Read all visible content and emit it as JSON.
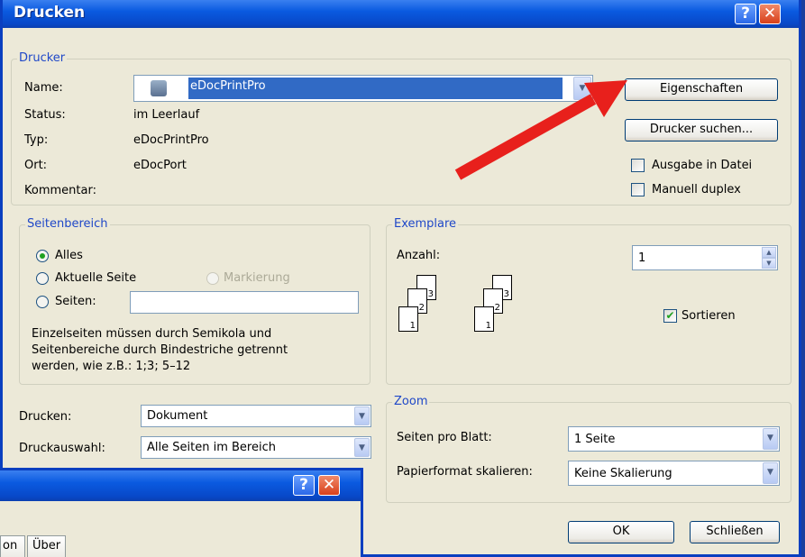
{
  "window": {
    "title": "Drucken",
    "help_glyph": "?",
    "close_glyph": "✕"
  },
  "printer": {
    "legend": "Drucker",
    "name_label": "Name:",
    "name_value": "eDocPrintPro",
    "status_label": "Status:",
    "status_value": "im Leerlauf",
    "type_label": "Typ:",
    "type_value": "eDocPrintPro",
    "location_label": "Ort:",
    "location_value": "eDocPort",
    "comment_label": "Kommentar:",
    "properties_button": "Eigenschaften",
    "find_printer_button": "Drucker suchen...",
    "print_to_file_label": "Ausgabe in Datei",
    "manual_duplex_label": "Manuell duplex"
  },
  "page_range": {
    "legend": "Seitenbereich",
    "all_label": "Alles",
    "current_page_label": "Aktuelle Seite",
    "selection_label": "Markierung",
    "pages_label": "Seiten:",
    "pages_value": "",
    "hint": "Einzelseiten müssen durch Semikola und Seitenbereiche durch Bindestriche getrennt werden, wie z.B.: 1;3; 5–12",
    "selected": "Alles"
  },
  "copies": {
    "legend": "Exemplare",
    "count_label": "Anzahl:",
    "count_value": "1",
    "collate_label": "Sortieren",
    "collate_checked": true
  },
  "print_what": {
    "print_label": "Drucken:",
    "print_value": "Dokument",
    "selection_label": "Druckauswahl:",
    "selection_value": "Alle Seiten im Bereich"
  },
  "zoom": {
    "legend": "Zoom",
    "pages_per_sheet_label": "Seiten pro Blatt:",
    "pages_per_sheet_value": "1 Seite",
    "scale_label": "Papierformat skalieren:",
    "scale_value": "Keine Skalierung"
  },
  "footer": {
    "ok_button": "OK",
    "close_button": "Schließen"
  },
  "second_window": {
    "tab_partial": "on",
    "tab_about": "Über"
  },
  "colors": {
    "accent": "#0a3fc0",
    "arrow": "#e8201c"
  }
}
